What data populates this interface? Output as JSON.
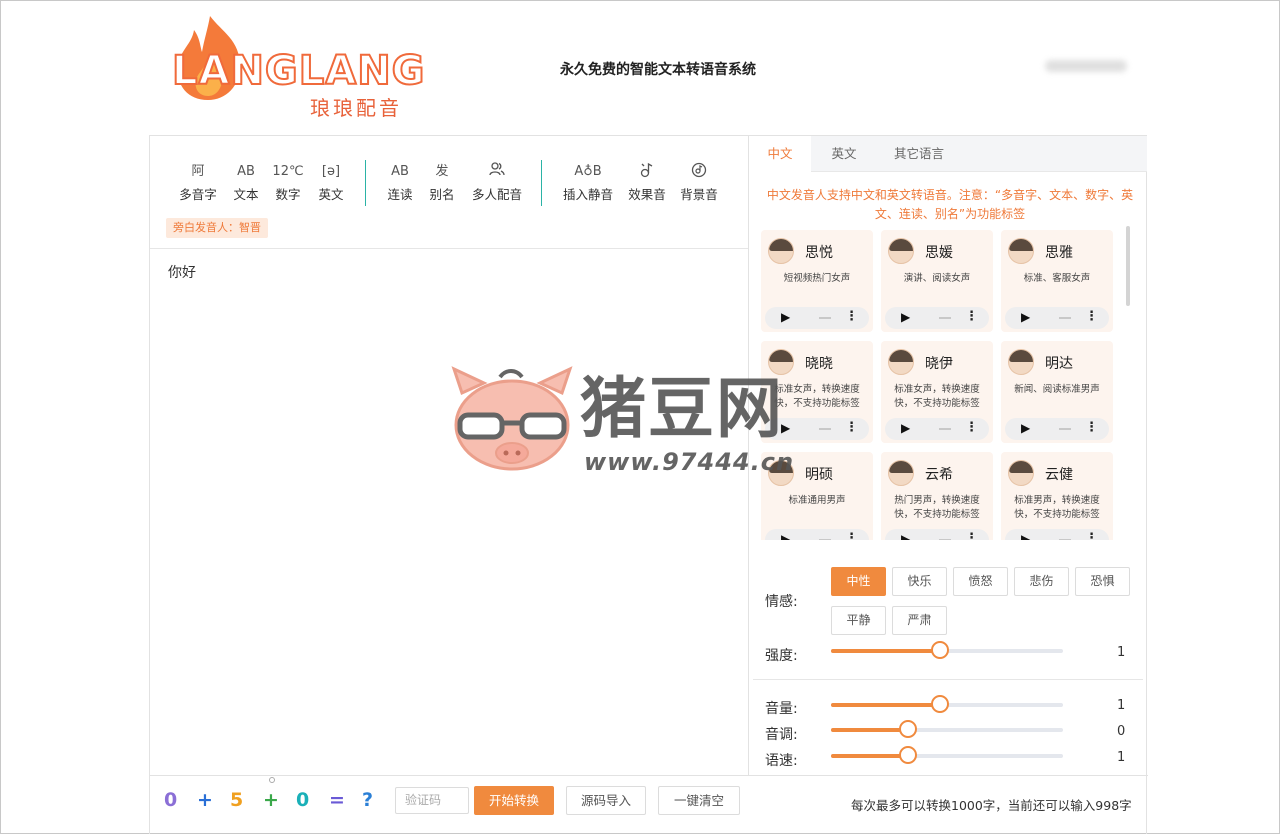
{
  "header": {
    "logo_text": "LANGLANG",
    "logo_sub": "琅琅配音",
    "site_title": "永久免费的智能文本转语音系统"
  },
  "toolbar": {
    "tools": [
      {
        "icon": "阿",
        "label": "多音字"
      },
      {
        "icon": "AB",
        "label": "文本"
      },
      {
        "icon": "12℃",
        "label": "数字"
      },
      {
        "icon": "[ə]",
        "label": "英文"
      },
      {
        "icon": "AB",
        "label": "连读"
      },
      {
        "icon": "发",
        "label": "别名"
      },
      {
        "icon": "people-icon",
        "label": "多人配音"
      },
      {
        "icon": "A♁B",
        "label": "插入静音"
      },
      {
        "icon": "effect-icon",
        "label": "效果音"
      },
      {
        "icon": "bgm-icon",
        "label": "背景音"
      }
    ],
    "narrator": "旁白发音人：智晋"
  },
  "editor": {
    "text": "你好"
  },
  "tabs": [
    "中文",
    "英文",
    "其它语言"
  ],
  "notice": "中文发音人支持中文和英文转语音。注意：“多音字、文本、数字、英文、连读、别名”为功能标签",
  "voices": [
    {
      "name": "思悦",
      "desc": "短视频热门女声"
    },
    {
      "name": "思媛",
      "desc": "演讲、阅读女声"
    },
    {
      "name": "思雅",
      "desc": "标准、客服女声"
    },
    {
      "name": "晓晓",
      "desc": "标准女声，转换速度快，不支持功能标签"
    },
    {
      "name": "晓伊",
      "desc": "标准女声，转换速度快，不支持功能标签"
    },
    {
      "name": "明达",
      "desc": "新闻、阅读标准男声"
    },
    {
      "name": "明硕",
      "desc": "标准通用男声"
    },
    {
      "name": "云希",
      "desc": "热门男声，转换速度快，不支持功能标签"
    },
    {
      "name": "云健",
      "desc": "标准男声，转换速度快，不支持功能标签"
    }
  ],
  "emotion": {
    "label": "情感:",
    "options": [
      "中性",
      "快乐",
      "愤怒",
      "悲伤",
      "恐惧",
      "平静",
      "严肃"
    ],
    "selected": "中性"
  },
  "sliders": [
    {
      "label": "强度:",
      "value": "1",
      "fraction": 0.47
    },
    {
      "label": "音量:",
      "value": "1",
      "fraction": 0.47
    },
    {
      "label": "音调:",
      "value": "0",
      "fraction": 0.33
    },
    {
      "label": "语速:",
      "value": "1",
      "fraction": 0.33
    }
  ],
  "bottom": {
    "captcha_placeholder": "验证码",
    "start_label": "开始转换",
    "import_label": "源码导入",
    "clear_label": "一键清空",
    "limit_text": "每次最多可以转换1000字，当前还可以输入998字",
    "captcha_chars": [
      "0",
      "+",
      "5",
      "+",
      "0",
      "=",
      "?"
    ],
    "captcha_colors": [
      "#8b6fd6",
      "#2a6fd6",
      "#f0a020",
      "#3aa84a",
      "#1ab0b8",
      "#6a5ad6",
      "#2a7fd6"
    ]
  },
  "watermark": {
    "text": "猪豆网",
    "url": "www.97444.cn"
  },
  "colors": {
    "accent": "#f08a3e",
    "notice": "#ef7a3a",
    "divider": "#2bb3a6"
  }
}
